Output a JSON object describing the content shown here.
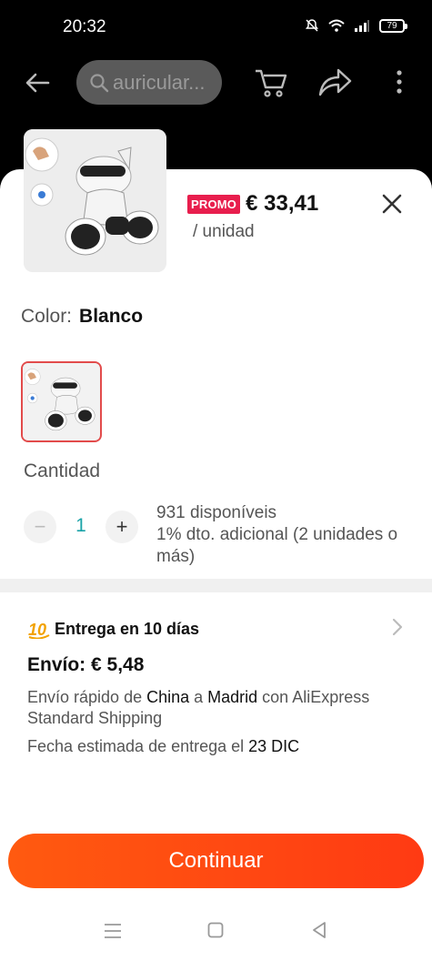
{
  "status_bar": {
    "time": "20:32",
    "battery": "79"
  },
  "app_bar": {
    "search_placeholder": "auricular..."
  },
  "product": {
    "promo_badge": "PROMO",
    "price": "€ 33,41",
    "unit": "/ unidad"
  },
  "color": {
    "label": "Color:",
    "selected": "Blanco"
  },
  "quantity": {
    "label": "Cantidad",
    "minus": "−",
    "value": "1",
    "plus": "+",
    "stock": "931 disponíveis",
    "discount": "1% dto. adicional (2 unidades o más)"
  },
  "delivery": {
    "title": "Entrega en 10 días",
    "cost": "Envío: € 5,48",
    "desc_1": "Envío rápido de ",
    "origin": "China",
    "desc_2": " a ",
    "destination": "Madrid",
    "desc_3": " con AliExpress Standard Shipping",
    "date_prefix": "Fecha estimada de entrega el ",
    "date": "23 DIC"
  },
  "actions": {
    "continue": "Continuar"
  },
  "colors": {
    "accent": "#ff4a12",
    "promo": "#e81e4d",
    "quantity_value": "#1aa3a8",
    "swatch_border": "#e24b4b"
  },
  "icons": [
    "back-arrow-icon",
    "search-icon",
    "cart-icon",
    "share-icon",
    "more-vertical-icon",
    "close-icon",
    "chevron-right-icon",
    "ten-days-icon",
    "nav-menu-icon",
    "nav-home-icon",
    "nav-back-icon"
  ]
}
